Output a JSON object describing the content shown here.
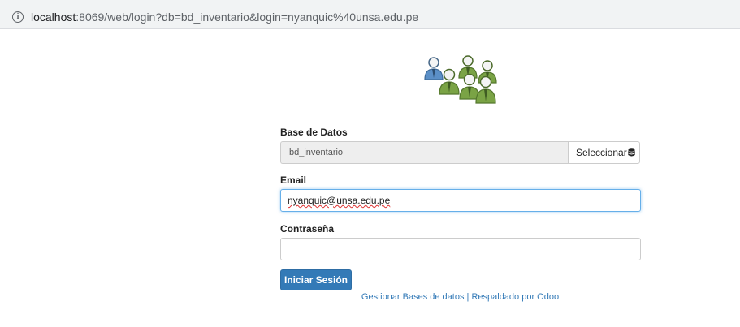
{
  "browser": {
    "url_host": "localhost",
    "url_rest": ":8069/web/login?db=bd_inventario&login=nyanquic%40unsa.edu.pe"
  },
  "form": {
    "database_label": "Base de Datos",
    "database_value": "bd_inventario",
    "select_button_label": "Seleccionar",
    "email_label": "Email",
    "email_value": "nyanquic@unsa.edu.pe",
    "password_label": "Contraseña",
    "password_value": "",
    "submit_label": "Iniciar Sesión"
  },
  "footer": {
    "manage_link": "Gestionar Bases de datos",
    "separator": "|",
    "powered_link": "Respaldado por Odoo"
  },
  "colors": {
    "primary": "#337ab7",
    "focus": "#66afe9",
    "logo_blue": "#5b8fc7",
    "logo_green": "#7aa345"
  }
}
